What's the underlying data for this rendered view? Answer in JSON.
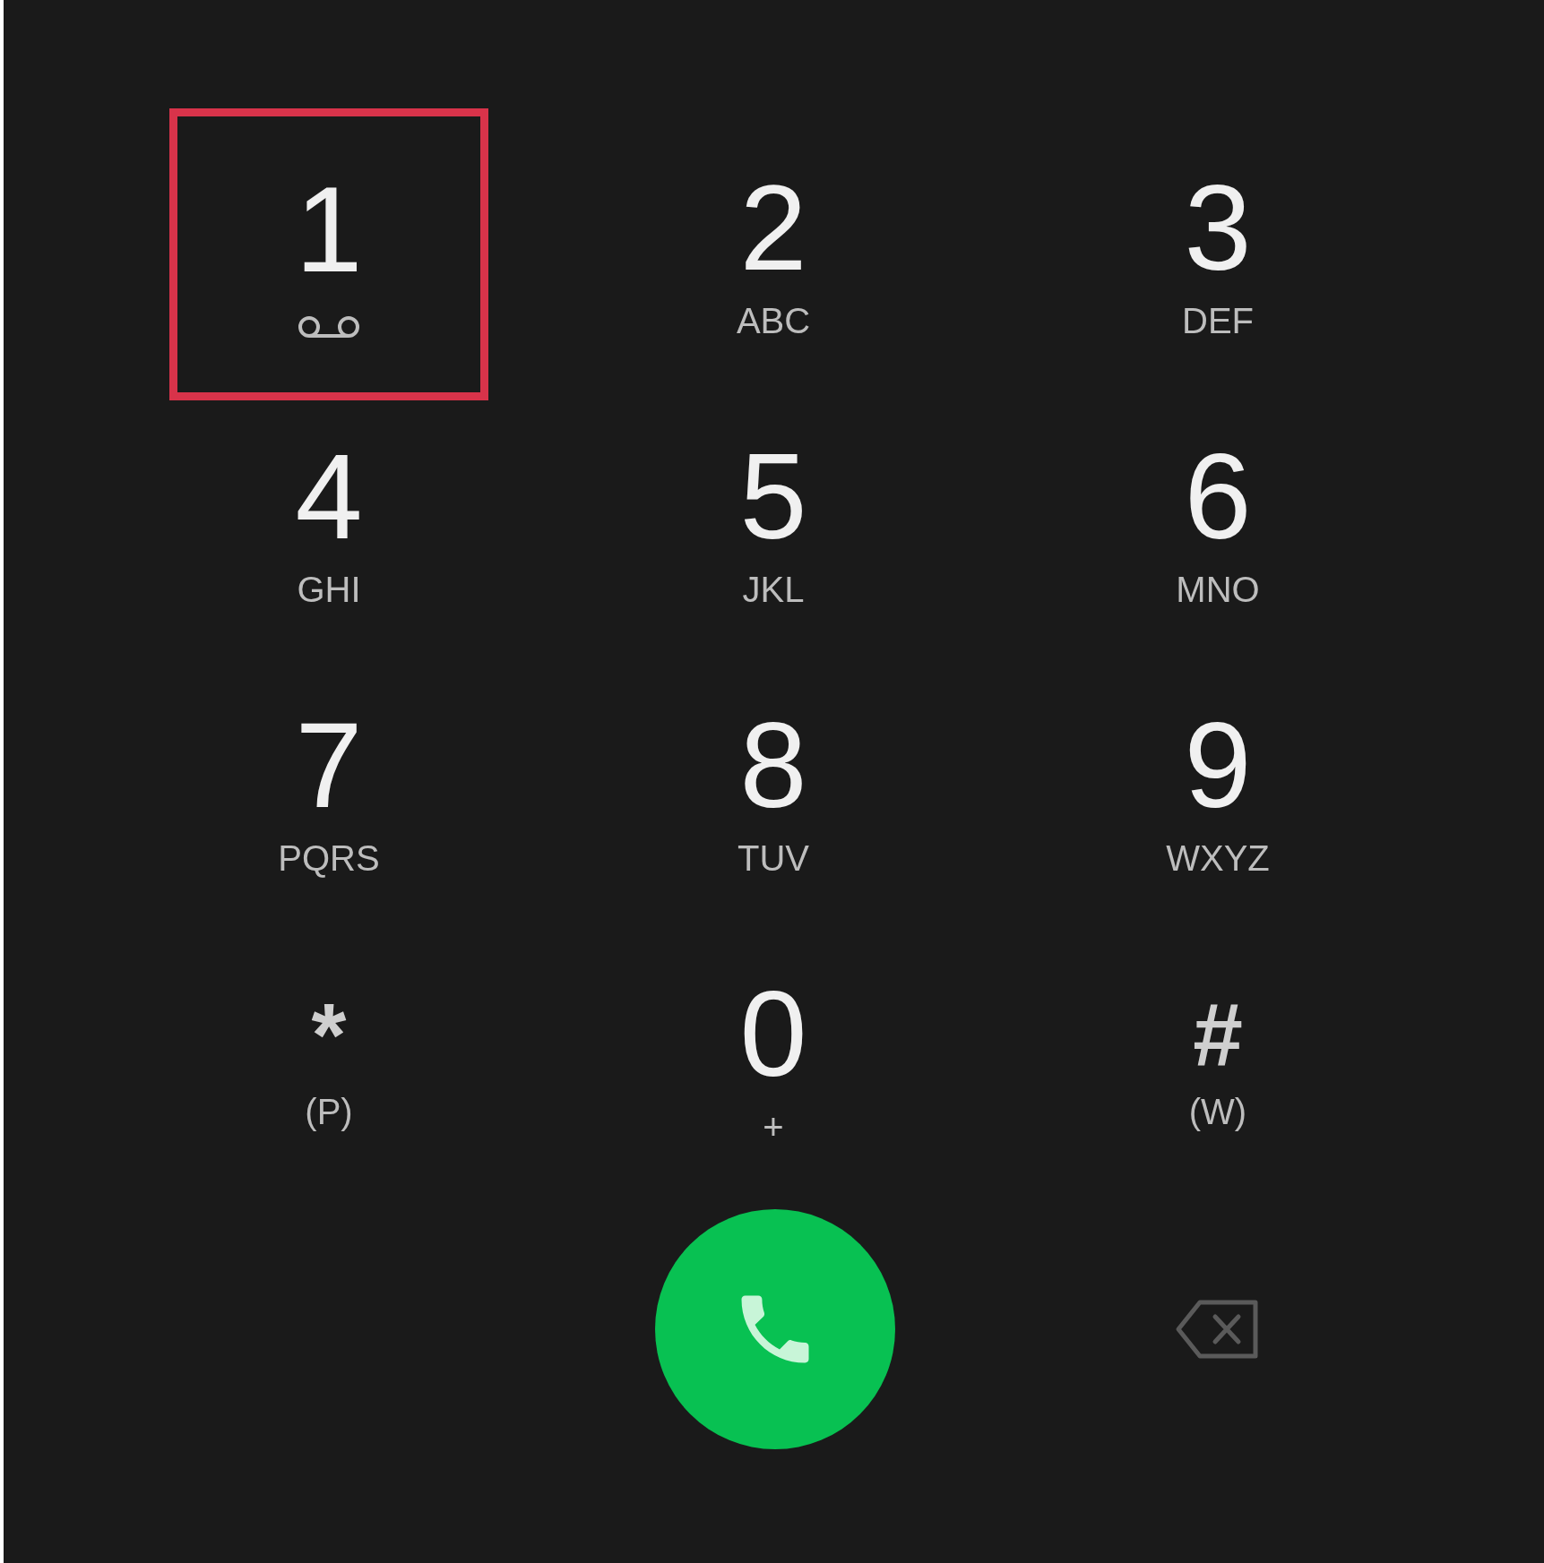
{
  "keys": [
    {
      "kind": "voicemail",
      "digit": "1",
      "highlighted": true
    },
    {
      "kind": "letters",
      "digit": "2",
      "sub": "ABC",
      "highlighted": false
    },
    {
      "kind": "letters",
      "digit": "3",
      "sub": "DEF",
      "highlighted": false
    },
    {
      "kind": "letters",
      "digit": "4",
      "sub": "GHI",
      "highlighted": false
    },
    {
      "kind": "letters",
      "digit": "5",
      "sub": "JKL",
      "highlighted": false
    },
    {
      "kind": "letters",
      "digit": "6",
      "sub": "MNO",
      "highlighted": false
    },
    {
      "kind": "letters",
      "digit": "7",
      "sub": "PQRS",
      "highlighted": false
    },
    {
      "kind": "letters",
      "digit": "8",
      "sub": "TUV",
      "highlighted": false
    },
    {
      "kind": "letters",
      "digit": "9",
      "sub": "WXYZ",
      "highlighted": false
    },
    {
      "kind": "symbol",
      "digit": "*",
      "sub": "(P)",
      "highlighted": false
    },
    {
      "kind": "letters",
      "digit": "0",
      "sub": "+",
      "highlighted": false
    },
    {
      "kind": "symbol",
      "digit": "#",
      "sub": "(W)",
      "highlighted": false
    }
  ]
}
